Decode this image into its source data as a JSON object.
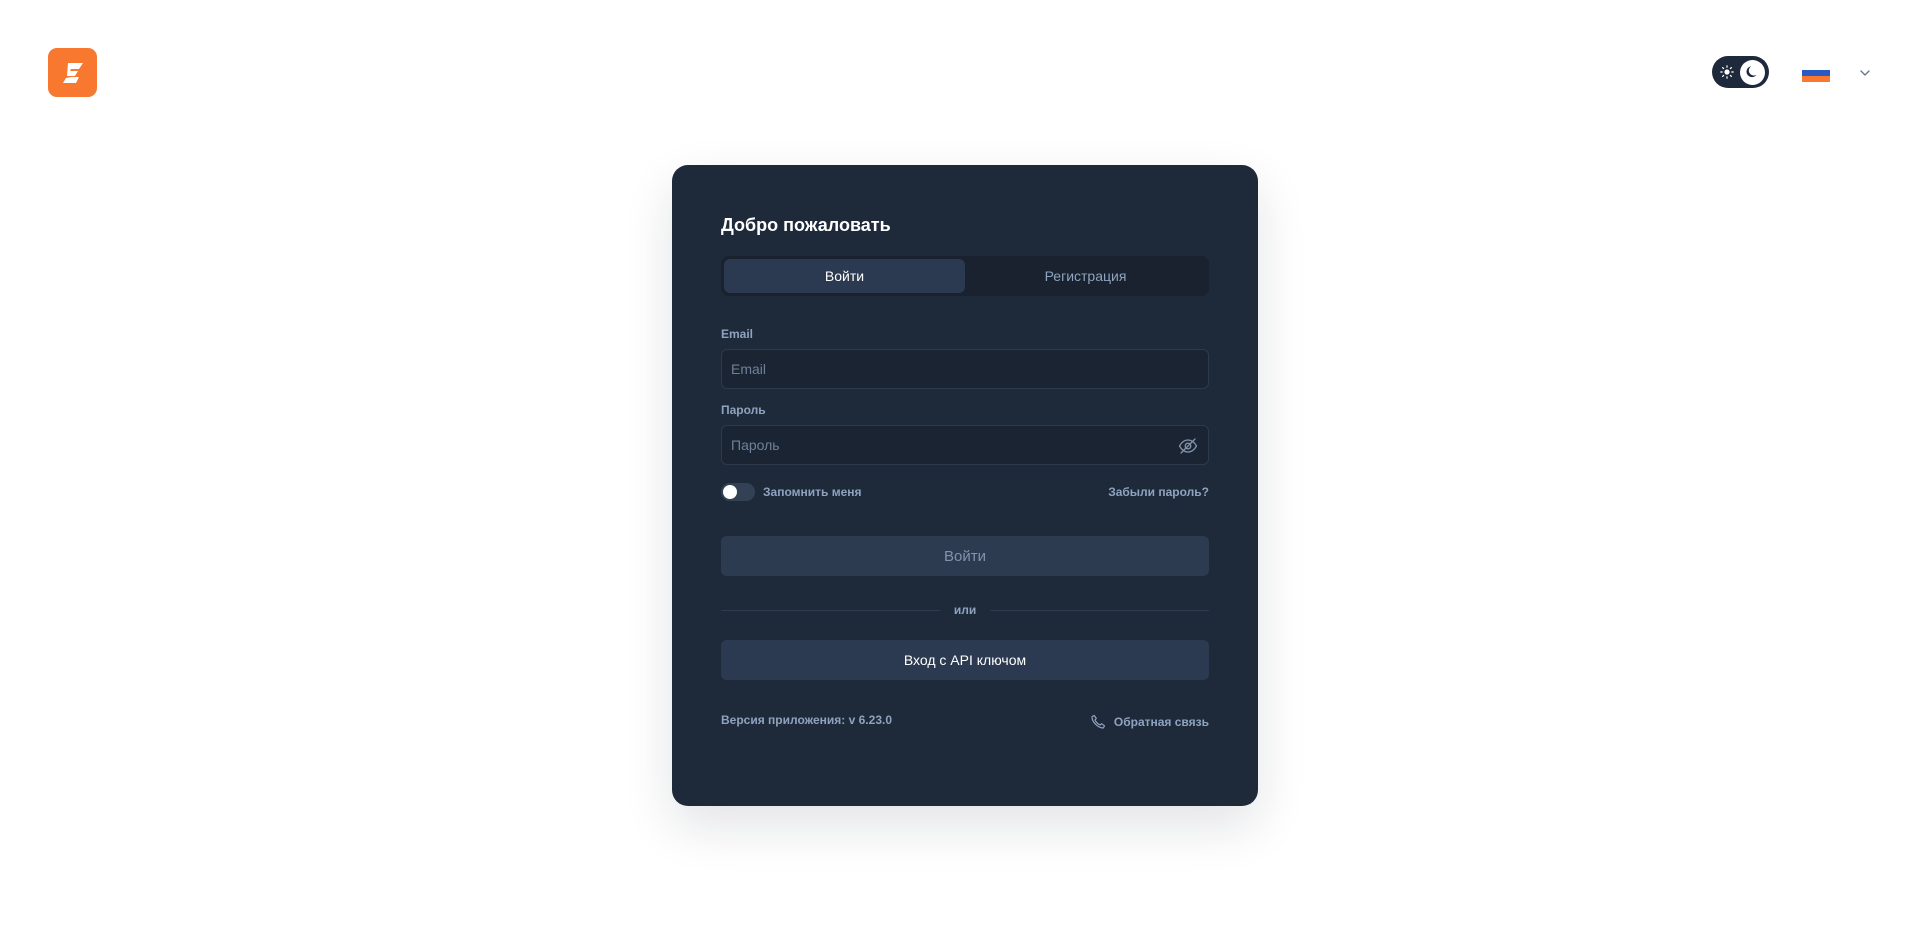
{
  "header": {
    "logo_icon": "bolt-logo-icon",
    "logo_color": "#f97830",
    "theme_toggle": {
      "light_icon": "sun-icon",
      "dark_icon": "moon-icon",
      "selected": "dark"
    },
    "language": {
      "flag_icon": "russia-flag-icon",
      "chevron_icon": "chevron-down-icon"
    }
  },
  "card": {
    "title": "Добро пожаловать",
    "tabs": [
      {
        "label": "Войти",
        "active": true
      },
      {
        "label": "Регистрация",
        "active": false
      }
    ],
    "email": {
      "label": "Email",
      "placeholder": "Email",
      "value": ""
    },
    "password": {
      "label": "Пароль",
      "placeholder": "Пароль",
      "value": "",
      "toggle_icon": "eye-off-icon"
    },
    "remember_me": {
      "label": "Запомнить меня",
      "checked": false
    },
    "forgot_password": "Забыли пароль?",
    "submit_label": "Войти",
    "divider_text": "или",
    "api_key_label": "Вход с API ключом",
    "version_text": "Версия приложения: v 6.23.0",
    "feedback": {
      "label": "Обратная связь",
      "icon": "phone-icon"
    }
  },
  "colors": {
    "card_bg": "#1e2a3a",
    "accent": "#f97830",
    "muted_text": "#8fa3bf"
  }
}
